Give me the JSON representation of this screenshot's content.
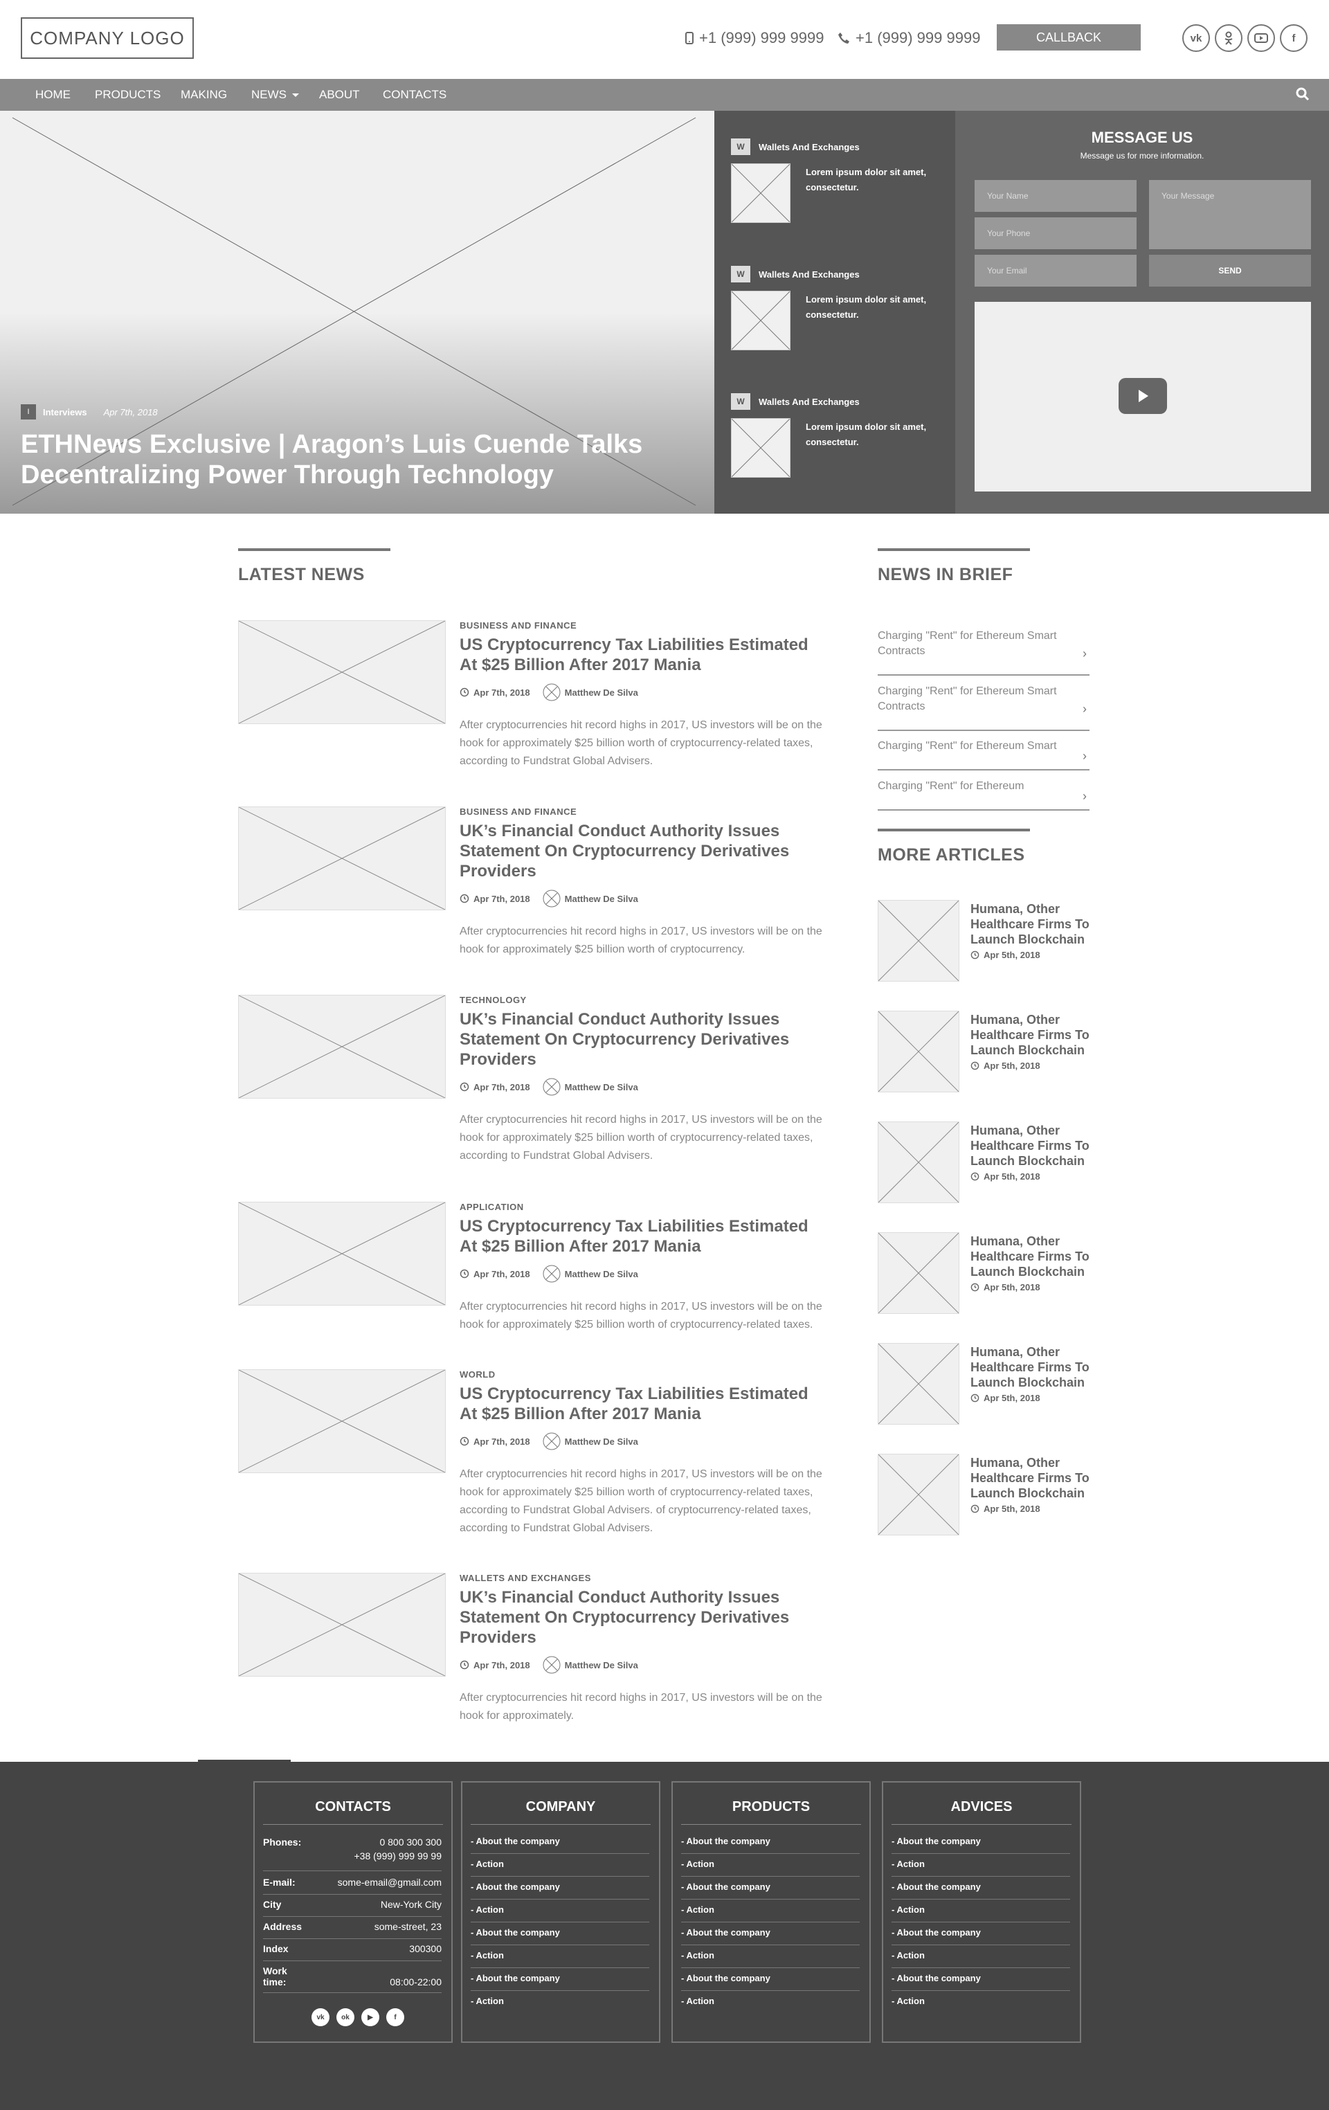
{
  "header": {
    "logo": "COMPANY LOGO",
    "phone1": "+1 (999) 999 9999",
    "phone2": "+1 (999) 999 9999",
    "callback_label": "CALLBACK",
    "social": [
      "vk-icon",
      "odnoklassniki-icon",
      "youtube-icon",
      "facebook-icon"
    ]
  },
  "nav": {
    "items": [
      "HOME",
      "PRODUCTS",
      "MAKING",
      "NEWS",
      "ABOUT",
      "CONTACTS"
    ]
  },
  "hero": {
    "badge": "I",
    "category": "Interviews",
    "date": "Apr 7th, 2018",
    "title": "ETHNews Exclusive | Aragon’s Luis Cuende Talks Decentralizing Power Through Technology"
  },
  "wallets": {
    "items": [
      {
        "badge": "W",
        "title": "Wallets And Exchanges",
        "text": "Lorem ipsum dolor sit amet, consectetur."
      },
      {
        "badge": "W",
        "title": "Wallets And Exchanges",
        "text": "Lorem ipsum dolor sit amet, consectetur."
      },
      {
        "badge": "W",
        "title": "Wallets And Exchanges",
        "text": "Lorem ipsum dolor sit amet, consectetur."
      }
    ]
  },
  "message": {
    "title": "MESSAGE US",
    "subtitle": "Message us for more information.",
    "name_placeholder": "Your Name",
    "phone_placeholder": "Your Phone",
    "email_placeholder": "Your Email",
    "message_placeholder": "Your Message",
    "send_label": "SEND"
  },
  "latest": {
    "title": "LATEST NEWS",
    "items": [
      {
        "category": "BUSINESS AND FINANCE",
        "title": "US Cryptocurrency Tax Liabilities Estimated At $25 Billion After 2017 Mania",
        "date": "Apr 7th, 2018",
        "author": "Matthew De Silva",
        "text": "After cryptocurrencies hit record highs in 2017, US investors will be on the hook for approximately $25 billion worth of cryptocurrency-related taxes, according to Fundstrat Global Advisers."
      },
      {
        "category": "BUSINESS AND FINANCE",
        "title": "UK’s Financial Conduct Authority Issues Statement On Cryptocurrency Derivatives Providers",
        "date": "Apr 7th, 2018",
        "author": "Matthew De Silva",
        "text": "After cryptocurrencies hit record highs in 2017, US investors will be on the hook for approximately $25 billion worth of cryptocurrency."
      },
      {
        "category": "TECHNOLOGY",
        "title": "UK’s Financial Conduct Authority Issues Statement On Cryptocurrency Derivatives Providers",
        "date": "Apr 7th, 2018",
        "author": "Matthew De Silva",
        "text": "After cryptocurrencies hit record highs in 2017, US investors will be on the hook for approximately $25 billion worth of cryptocurrency-related taxes, according to Fundstrat Global Advisers."
      },
      {
        "category": "APPLICATION",
        "title": "US Cryptocurrency Tax Liabilities Estimated At $25 Billion After 2017 Mania",
        "date": "Apr 7th, 2018",
        "author": "Matthew De Silva",
        "text": "After cryptocurrencies hit record highs in 2017, US investors will be on the hook for approximately $25 billion worth of cryptocurrency-related taxes."
      },
      {
        "category": "WORLD",
        "title": "US Cryptocurrency Tax Liabilities Estimated At $25 Billion After 2017 Mania",
        "date": "Apr 7th, 2018",
        "author": "Matthew De Silva",
        "text": "After cryptocurrencies hit record highs in 2017, US investors will be on the hook for approximately $25 billion worth of cryptocurrency-related taxes, according to Fundstrat Global Advisers. of cryptocurrency-related taxes, according to Fundstrat Global Advisers."
      },
      {
        "category": "WALLETS AND EXCHANGES",
        "title": "UK’s Financial Conduct Authority Issues Statement On Cryptocurrency Derivatives Providers",
        "date": "Apr 7th, 2018",
        "author": "Matthew De Silva",
        "text": "After cryptocurrencies hit record highs in 2017, US investors will be on the hook for approximately."
      }
    ]
  },
  "brief": {
    "title": "NEWS IN BRIEF",
    "items": [
      "Charging \"Rent\" for Ethereum Smart Contracts",
      "Charging \"Rent\" for Ethereum Smart Contracts",
      "Charging \"Rent\" for Ethereum Smart",
      "Charging \"Rent\" for Ethereum"
    ]
  },
  "more": {
    "title": "MORE ARTICLES",
    "items": [
      {
        "title": "Humana, Other Healthcare Firms To Launch Blockchain",
        "date": "Apr 5th, 2018"
      },
      {
        "title": "Humana, Other Healthcare Firms To Launch Blockchain",
        "date": "Apr 5th, 2018"
      },
      {
        "title": "Humana, Other Healthcare Firms To Launch Blockchain",
        "date": "Apr 5th, 2018"
      },
      {
        "title": "Humana, Other Healthcare Firms To Launch Blockchain",
        "date": "Apr 5th, 2018"
      },
      {
        "title": "Humana, Other Healthcare Firms To Launch Blockchain",
        "date": "Apr 5th, 2018"
      },
      {
        "title": "Humana, Other Healthcare Firms To Launch Blockchain",
        "date": "Apr 5th, 2018"
      }
    ]
  },
  "footer": {
    "contacts": {
      "title": "CONTACTS",
      "rows": [
        {
          "k": "Phones:",
          "v1": "0 800 300 300",
          "v2": "+38 (999) 999 99 99"
        },
        {
          "k": "E-mail:",
          "v1": "some-email@gmail.com"
        },
        {
          "k": "City",
          "v1": "New-York City"
        },
        {
          "k": "Address",
          "v1": "some-street, 23"
        },
        {
          "k": "Index",
          "v1": "300300"
        },
        {
          "k": "Work time:",
          "v1": "08:00-22:00"
        }
      ],
      "social": [
        "vk-icon",
        "odnoklassniki-icon",
        "youtube-icon",
        "facebook-icon"
      ]
    },
    "company": {
      "title": "COMPANY",
      "links": [
        "- About the company",
        "- Action",
        "- About the company",
        "- Action",
        "- About the company",
        "- Action",
        "- About the company",
        "- Action"
      ]
    },
    "products": {
      "title": "PRODUCTS",
      "links": [
        "- About the company",
        "- Action",
        "- About the company",
        "- Action",
        "- About the company",
        "- Action",
        "- About the company",
        "- Action"
      ]
    },
    "advices": {
      "title": "ADVICES",
      "links": [
        "- About the company",
        "- Action",
        "- About the company",
        "- Action",
        "- About the company",
        "- Action",
        "- About the company",
        "- Action"
      ]
    }
  }
}
